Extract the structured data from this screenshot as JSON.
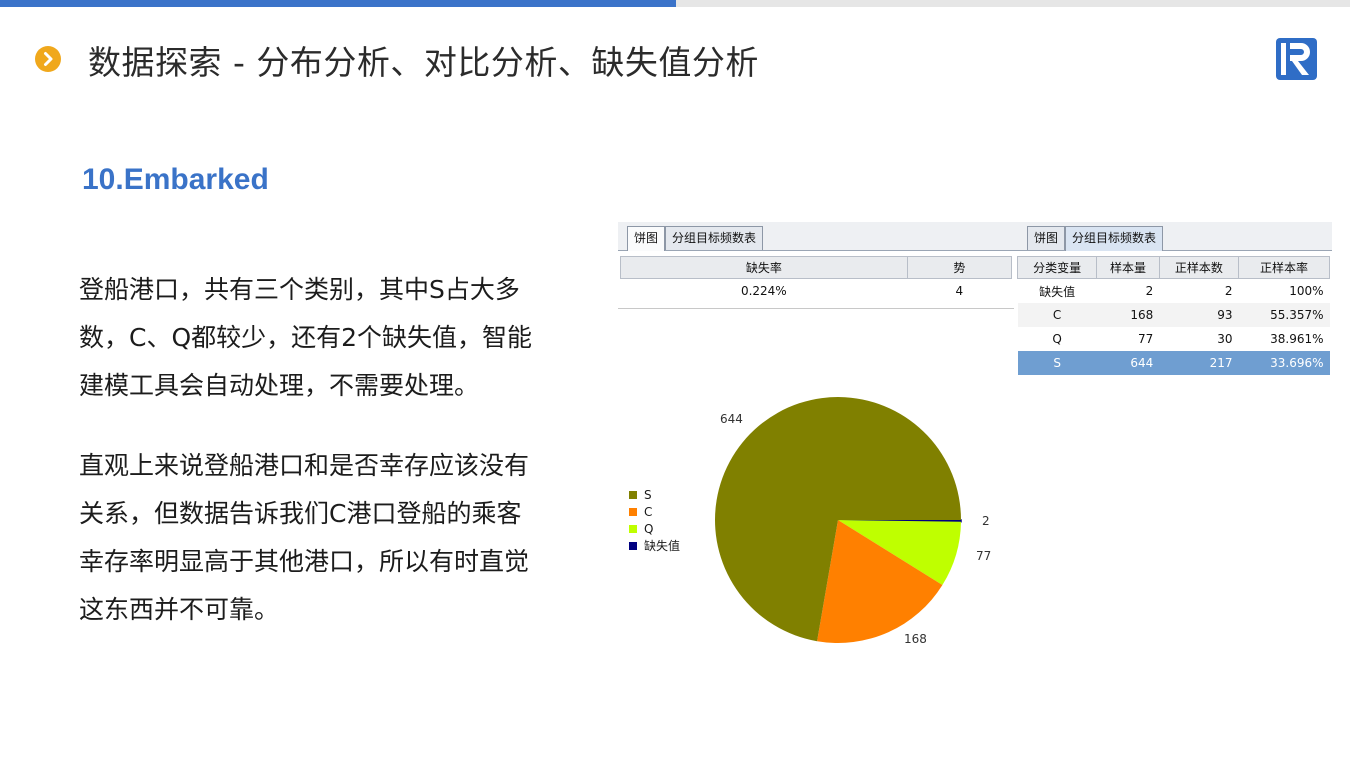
{
  "slide": {
    "title": "数据探索 - 分布分析、对比分析、缺失值分析",
    "section_heading": "10.Embarked",
    "paragraph1_lines": [
      "登船港口，共有三个类别，其中S占大多",
      "数，C、Q都较少，还有2个缺失值，智能",
      "建模工具会自动处理，不需要处理。"
    ],
    "paragraph2_lines": [
      "直观上来说登船港口和是否幸存应该没有",
      "关系，但数据告诉我们C港口登船的乘客",
      "幸存率明显高于其他港口，所以有时直觉",
      "这东西并不可靠。"
    ]
  },
  "panel_left": {
    "tabs": [
      "饼图",
      "分组目标频数表"
    ],
    "active_tab": "饼图",
    "headers": [
      "缺失率",
      "势"
    ],
    "row": [
      "0.224%",
      "4"
    ]
  },
  "panel_right": {
    "tabs": [
      "饼图",
      "分组目标频数表"
    ],
    "active_tab": "分组目标频数表",
    "headers": [
      "分类变量",
      "样本量",
      "正样本数",
      "正样本率"
    ],
    "rows": [
      [
        "缺失值",
        "2",
        "2",
        "100%"
      ],
      [
        "C",
        "168",
        "93",
        "55.357%"
      ],
      [
        "Q",
        "77",
        "30",
        "38.961%"
      ],
      [
        "S",
        "644",
        "217",
        "33.696%"
      ]
    ],
    "selected_row": 3
  },
  "colors": {
    "accent_blue": "#3b73c9",
    "bullet": "#f0a81c",
    "S": "#808000",
    "C": "#ff8000",
    "Q": "#bfff00",
    "missing": "#000080"
  },
  "chart_data": {
    "type": "pie",
    "categories": [
      "S",
      "C",
      "Q",
      "缺失值"
    ],
    "values": [
      644,
      168,
      77,
      2
    ],
    "data_labels": [
      "644",
      "168",
      "77",
      "2"
    ],
    "legend": [
      "S",
      "C",
      "Q",
      "缺失值"
    ],
    "legend_position": "left"
  }
}
